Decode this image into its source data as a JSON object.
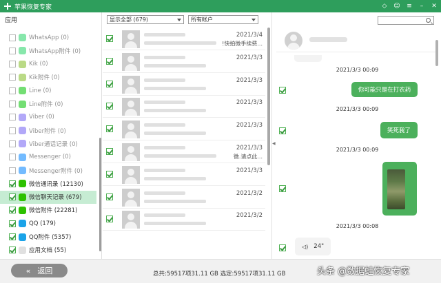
{
  "window": {
    "title": "苹果恢复专家",
    "controls": [
      "diamond-icon",
      "feedback-icon",
      "menu-icon",
      "minimize-icon",
      "close-icon"
    ]
  },
  "sidebar": {
    "section_label": "应用",
    "items": [
      {
        "label": "WhatsApp (0)",
        "checked": false,
        "icon": "whatsapp-icon",
        "color": "#25d366",
        "dim": true
      },
      {
        "label": "WhatsApp附件 (0)",
        "checked": false,
        "icon": "whatsapp-attachment-icon",
        "color": "#25d366",
        "dim": true
      },
      {
        "label": "Kik (0)",
        "checked": false,
        "icon": "kik-icon",
        "color": "#82bc23",
        "dim": true
      },
      {
        "label": "Kik附件 (0)",
        "checked": false,
        "icon": "kik-attachment-icon",
        "color": "#82bc23",
        "dim": true
      },
      {
        "label": "Line (0)",
        "checked": false,
        "icon": "line-icon",
        "color": "#00c300",
        "dim": true
      },
      {
        "label": "Line附件 (0)",
        "checked": false,
        "icon": "line-attachment-icon",
        "color": "#00c300",
        "dim": true
      },
      {
        "label": "Viber (0)",
        "checked": false,
        "icon": "viber-icon",
        "color": "#7360f2",
        "dim": true
      },
      {
        "label": "Viber附件 (0)",
        "checked": false,
        "icon": "viber-attachment-icon",
        "color": "#7360f2",
        "dim": true
      },
      {
        "label": "Viber通话记录 (0)",
        "checked": false,
        "icon": "viber-call-icon",
        "color": "#7360f2",
        "dim": true
      },
      {
        "label": "Messenger (0)",
        "checked": false,
        "icon": "messenger-icon",
        "color": "#0084ff",
        "dim": true
      },
      {
        "label": "Messenger附件 (0)",
        "checked": false,
        "icon": "messenger-attachment-icon",
        "color": "#0084ff",
        "dim": true
      },
      {
        "label": "微信通讯录 (12130)",
        "checked": true,
        "icon": "wechat-contacts-icon",
        "color": "#2dc100",
        "dim": false
      },
      {
        "label": "微信聊天记录 (679)",
        "checked": true,
        "icon": "wechat-chat-icon",
        "color": "#2dc100",
        "dim": false,
        "selected": true
      },
      {
        "label": "微信附件 (22281)",
        "checked": true,
        "icon": "wechat-attachment-icon",
        "color": "#2dc100",
        "dim": false
      },
      {
        "label": "QQ (179)",
        "checked": true,
        "icon": "qq-icon",
        "color": "#1aa3e8",
        "dim": false
      },
      {
        "label": "QQ附件 (5357)",
        "checked": true,
        "icon": "qq-attachment-icon",
        "color": "#1aa3e8",
        "dim": false
      },
      {
        "label": "应用文档 (55)",
        "checked": true,
        "icon": "app-document-icon",
        "color": "#e0e0e0",
        "dim": false
      }
    ]
  },
  "filters": {
    "type_select": "显示全部 (679)",
    "account_select": "所有帐户"
  },
  "messages": [
    {
      "date": "2021/3/4",
      "preview": "!快拍微手续费...",
      "checked": true
    },
    {
      "date": "2021/3/3",
      "preview": "",
      "checked": true
    },
    {
      "date": "2021/3/3",
      "preview": "",
      "checked": true
    },
    {
      "date": "2021/3/3",
      "preview": "",
      "checked": true
    },
    {
      "date": "2021/3/3",
      "preview": "",
      "checked": true
    },
    {
      "date": "2021/3/3",
      "preview": "微.请点此...",
      "checked": true
    },
    {
      "date": "2021/3/3",
      "preview": "",
      "checked": true
    },
    {
      "date": "2021/3/2",
      "preview": "",
      "checked": true
    },
    {
      "date": "2021/3/2",
      "preview": "",
      "checked": true
    }
  ],
  "chat": {
    "messages": [
      {
        "time": "2021/3/3 00:09",
        "text": "你可能只是在打农药",
        "type": "out"
      },
      {
        "time": "2021/3/3 00:09",
        "text": "笑死我了",
        "type": "out"
      },
      {
        "time": "2021/3/3 00:09",
        "text": "",
        "type": "image"
      },
      {
        "time": "2021/3/3 00:08",
        "text": "24\"",
        "type": "voice"
      }
    ]
  },
  "bottom": {
    "back_label": "返回",
    "totals": "总共:59517项31.11 GB 选定:59517项31.11 GB"
  },
  "watermark": "头条 @数据蛙恢复专家"
}
